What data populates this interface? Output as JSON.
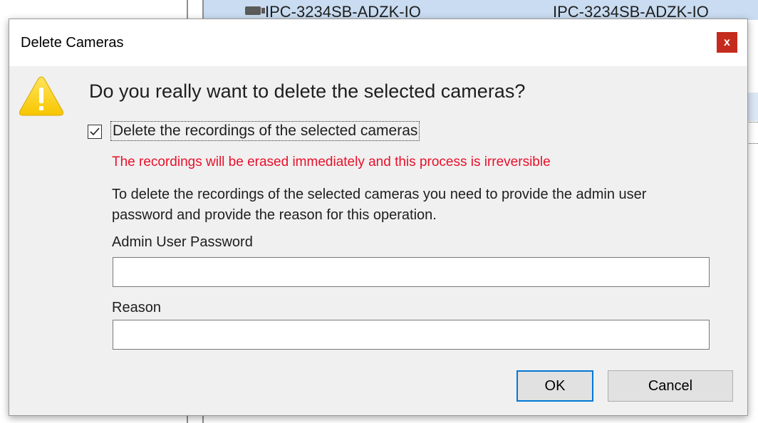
{
  "background": {
    "camera_row": {
      "name": "IPC-3234SB-ADZK-IO",
      "model": "IPC-3234SB-ADZK-IO"
    }
  },
  "dialog": {
    "title": "Delete Cameras",
    "close_label": "x",
    "question": "Do you really want to delete the selected cameras?",
    "delete_recordings": {
      "label": "Delete the recordings of the selected cameras",
      "checked": true
    },
    "warning": "The recordings will be erased immediately and this process is irreversible",
    "info": "To delete the recordings of the selected cameras you need to provide the admin user password and provide the reason for this operation.",
    "password": {
      "label": "Admin User Password",
      "value": ""
    },
    "reason": {
      "label": "Reason",
      "value": ""
    },
    "ok_label": "OK",
    "cancel_label": "Cancel"
  },
  "colors": {
    "close_button": "#c42b1c",
    "warning_text": "#e8102a",
    "default_button_border": "#0078d7",
    "warning_icon": "#ffd42a"
  }
}
